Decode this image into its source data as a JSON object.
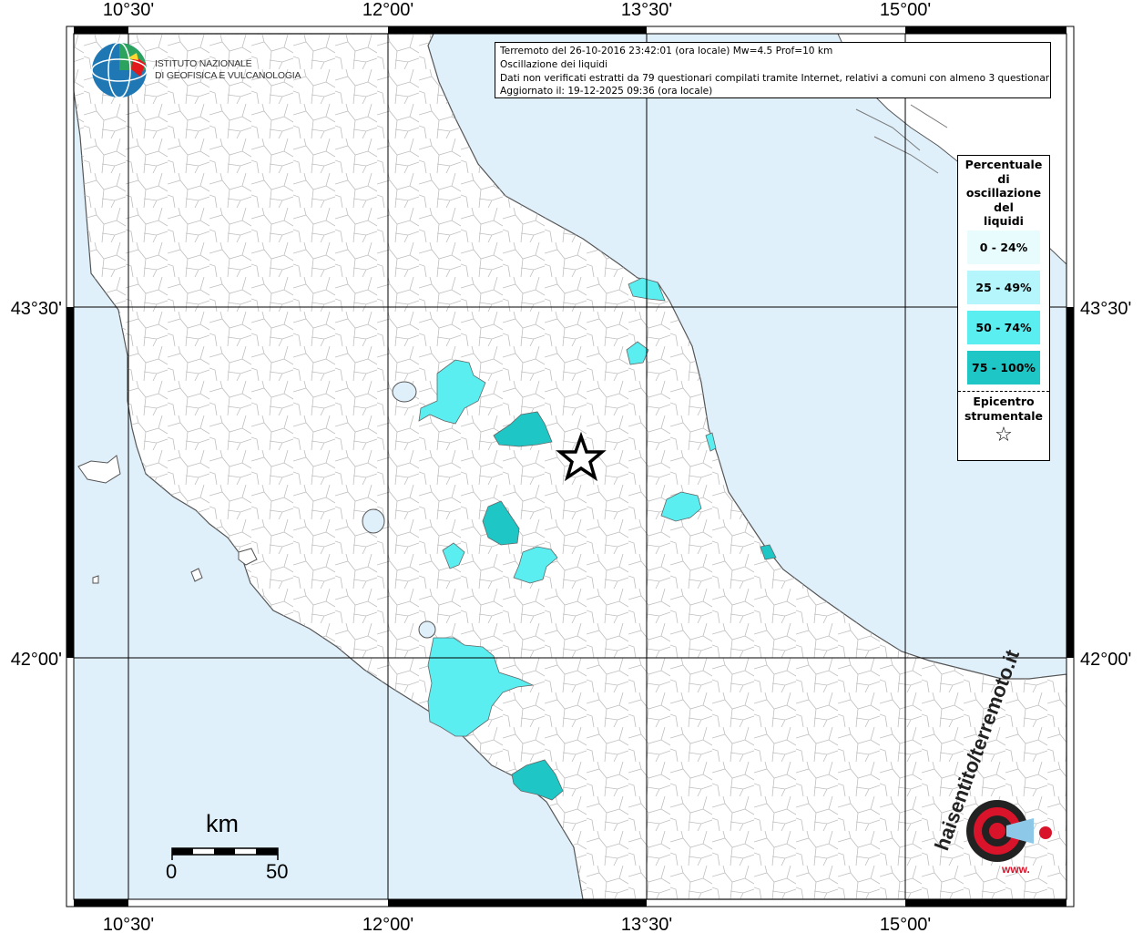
{
  "info": {
    "line1": "Terremoto del 26-10-2016 23:42:01 (ora locale) Mw=4.5 Prof=10 km",
    "line2": "Oscillazione dei liquidi",
    "line3": "Dati non verificati estratti da 79 questionari compilati tramite Internet, relativi a comuni con almeno 3 questionari.",
    "line4": "Aggiornato il: 19-12-2025 09:36 (ora locale)"
  },
  "logo": {
    "line1": "ISTITUTO NAZIONALE",
    "line2": "DI GEOFISICA E VULCANOLOGIA"
  },
  "axes": {
    "lon_labels": [
      "10°30'",
      "12°00'",
      "13°30'",
      "15°00'"
    ],
    "lat_labels": [
      "43°30'",
      "42°00'"
    ]
  },
  "legend": {
    "title_lines": [
      "Percentuale",
      "di",
      "oscillazione",
      "del",
      "liquidi"
    ],
    "classes": [
      {
        "label": "0 - 24%",
        "color": "#e8fcfd"
      },
      {
        "label": "25 - 49%",
        "color": "#b4f6fb"
      },
      {
        "label": "50 - 74%",
        "color": "#5aeef0"
      },
      {
        "label": "75 - 100%",
        "color": "#1fc6c6"
      }
    ],
    "epicenter_lines": [
      "Epicentro",
      "strumentale"
    ],
    "epicenter_symbol": "☆"
  },
  "scale": {
    "title": "km",
    "start": "0",
    "end": "50"
  },
  "watermark": {
    "ring_text": "haisentito/terremoto.it",
    "url_text": "www."
  },
  "colors": {
    "sea": "#e0f0fb",
    "land": "#ffffff",
    "cyan_light": "#b4f6fb",
    "cyan_mid": "#5aeef0",
    "cyan_dark": "#1fc6c6",
    "brand_red": "#d9132a"
  }
}
